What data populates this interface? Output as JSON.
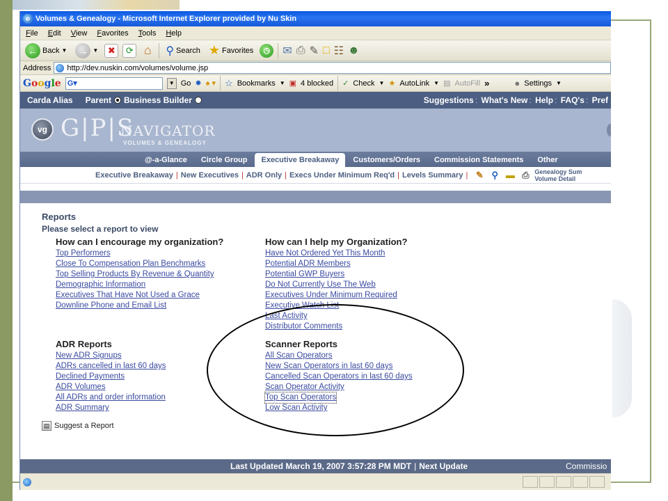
{
  "window": {
    "title": "Volumes & Genealogy - Microsoft Internet Explorer provided by Nu Skin"
  },
  "menu": [
    "File",
    "Edit",
    "View",
    "Favorites",
    "Tools",
    "Help"
  ],
  "toolbar": {
    "back": "Back",
    "search": "Search",
    "favorites": "Favorites"
  },
  "address": {
    "label": "Address",
    "url": "http://dev.nuskin.com/volumes/volume.jsp"
  },
  "googlebar": {
    "logo": "Google",
    "go": "Go",
    "bookmarks": "Bookmarks",
    "blocked": "4 blocked",
    "check": "Check",
    "autolink": "AutoLink",
    "autofill": "AutoFill",
    "more": "»",
    "settings": "Settings"
  },
  "site": {
    "user": "Carda Alias",
    "parent_label": "Parent",
    "business_builder_label": "Business Builder",
    "links": [
      "Suggestions",
      "What's New",
      "Help",
      "FAQ's",
      "Pref"
    ]
  },
  "banner": {
    "vg": "vg",
    "gps": "G|P|S",
    "navigator": "NAVIGATOR",
    "subtitle": "VOLUMES & GENEALOGY"
  },
  "nav_tabs": [
    {
      "label": "@-a-Glance",
      "active": false
    },
    {
      "label": "Circle Group",
      "active": false
    },
    {
      "label": "Executive Breakaway",
      "active": true
    },
    {
      "label": "Customers/Orders",
      "active": false
    },
    {
      "label": "Commission Statements",
      "active": false
    },
    {
      "label": "Other",
      "active": false
    }
  ],
  "subnav": [
    "Executive Breakaway",
    "New Executives",
    "ADR Only",
    "Execs Under Minimum Req'd",
    "Levels Summary"
  ],
  "subnav_extra": {
    "line1": "Genealogy Sum",
    "line2": "Volume Detail"
  },
  "reports": {
    "title": "Reports",
    "subtitle": "Please select a report to view",
    "encourage": {
      "heading": "How can I encourage my organization?",
      "links": [
        "Top Performers",
        "Close To Compensation Plan Benchmarks",
        "Top Selling Products By Revenue & Quantity",
        "Demographic Information",
        "Executives That Have Not Used a Grace",
        "Downline Phone and Email List"
      ]
    },
    "help": {
      "heading": "How can I help my Organization?",
      "links": [
        "Have Not Ordered Yet This Month",
        "Potential ADR Members",
        "Potential GWP Buyers",
        "Do Not Currently Use The Web",
        "Executives Under Minimum Required",
        "Executive Watch List",
        "Last Activity",
        "Distributor Comments"
      ]
    },
    "adr": {
      "heading": "ADR Reports",
      "links": [
        "New ADR Signups",
        "ADRs cancelled in last 60 days",
        "Declined Payments",
        "ADR Volumes",
        "All ADRs and order information",
        "ADR Summary"
      ]
    },
    "scanner": {
      "heading": "Scanner Reports",
      "links": [
        "All Scan Operators",
        "New Scan Operators in last 60 days",
        "Cancelled Scan Operators in last 60 days",
        "Scan Operator Activity",
        "Top Scan Operators",
        "Low Scan Activity"
      ]
    },
    "suggest": "Suggest a Report"
  },
  "footer": {
    "updated": "Last Updated March 19, 2007 3:57:28 PM MDT",
    "next": "Next Update",
    "right": "Commissio"
  }
}
